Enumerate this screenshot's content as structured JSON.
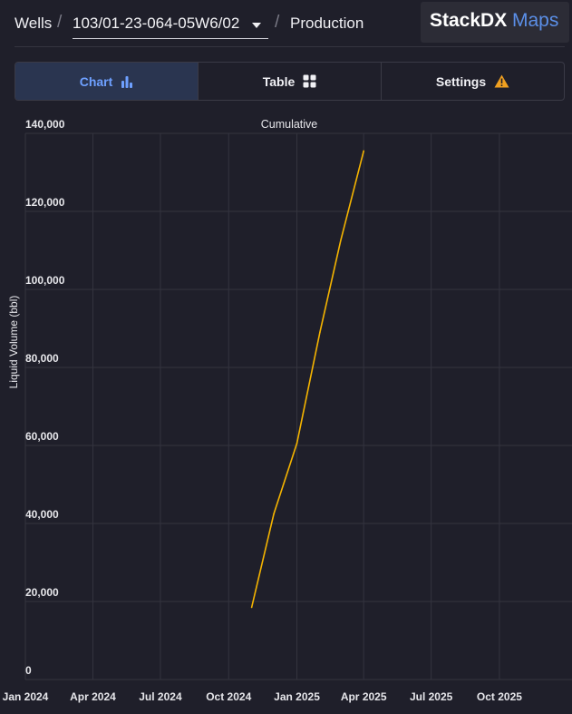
{
  "breadcrumb": {
    "wells": "Wells",
    "separator": "/",
    "well_id": "103/01-23-064-05W6/02",
    "production": "Production"
  },
  "logo": {
    "part1": "StackDX",
    "part2": "Maps"
  },
  "tabs": [
    {
      "label": "Chart",
      "icon": "bar-chart-icon",
      "active": true
    },
    {
      "label": "Table",
      "icon": "grid-icon",
      "active": false
    },
    {
      "label": "Settings",
      "icon": "warning-icon",
      "active": false
    }
  ],
  "colors": {
    "background": "#1f1f2a",
    "accent": "#6ea0ff",
    "line": "#f5b400",
    "warning": "#f0a020"
  },
  "chart_data": {
    "type": "line",
    "title": "Cumulative",
    "xlabel": "",
    "ylabel": "Liquid Volume (bbl)",
    "ylim": [
      0,
      140000
    ],
    "yticks": [
      0,
      20000,
      40000,
      60000,
      80000,
      100000,
      120000,
      140000
    ],
    "ytick_labels": [
      "0",
      "20,000",
      "40,000",
      "60,000",
      "80,000",
      "100,000",
      "120,000",
      "140,000"
    ],
    "xlim": [
      "2024-01-01",
      "2025-12-01"
    ],
    "xticks": [
      "2024-01-01",
      "2024-04-01",
      "2024-07-01",
      "2024-10-01",
      "2025-01-01",
      "2025-04-01",
      "2025-07-01",
      "2025-10-01"
    ],
    "xtick_labels": [
      "Jan 2024",
      "Apr 2024",
      "Jul 2024",
      "Oct 2024",
      "Jan 2025",
      "Apr 2025",
      "Jul 2025",
      "Oct 2025"
    ],
    "grid": true,
    "series": [
      {
        "x": [
          "2024-11-01",
          "2024-12-01",
          "2025-01-01",
          "2025-02-01",
          "2025-03-01",
          "2025-04-01"
        ],
        "y": [
          18500,
          42500,
          60500,
          89000,
          112500,
          135500
        ]
      }
    ]
  }
}
